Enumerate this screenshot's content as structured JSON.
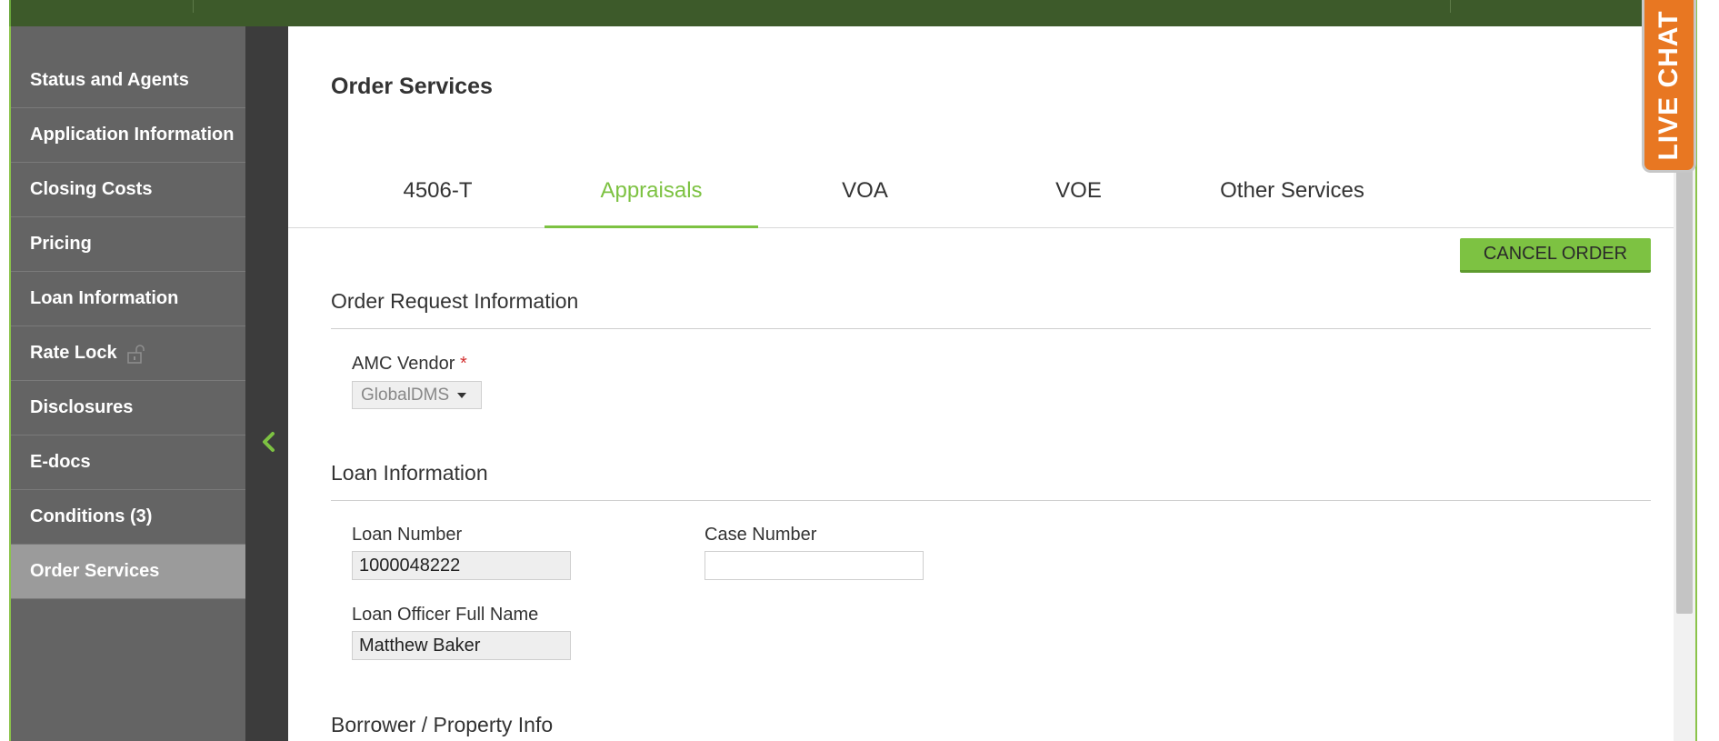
{
  "sidebar": {
    "items": [
      {
        "label": "Status and Agents"
      },
      {
        "label": "Application Information"
      },
      {
        "label": "Closing Costs"
      },
      {
        "label": "Pricing"
      },
      {
        "label": "Loan Information"
      },
      {
        "label": "Rate Lock",
        "icon": "unlock-icon"
      },
      {
        "label": "Disclosures"
      },
      {
        "label": "E-docs"
      },
      {
        "label": "Conditions (3)"
      },
      {
        "label": "Order Services",
        "active": true
      }
    ]
  },
  "main": {
    "page_title": "Order Services",
    "tabs": [
      {
        "label": "4506-T"
      },
      {
        "label": "Appraisals",
        "active": true
      },
      {
        "label": "VOA"
      },
      {
        "label": "VOE"
      },
      {
        "label": "Other Services"
      }
    ],
    "cancel_button": "CANCEL ORDER",
    "order_request": {
      "title": "Order Request Information",
      "amc_vendor_label": "AMC Vendor",
      "required_mark": "*",
      "amc_vendor_value": "GlobalDMS"
    },
    "loan_info": {
      "title": "Loan Information",
      "loan_number_label": "Loan Number",
      "loan_number_value": "1000048222",
      "case_number_label": "Case Number",
      "case_number_value": "",
      "loan_officer_label": "Loan Officer Full Name",
      "loan_officer_value": "Matthew Baker"
    },
    "borrower_section_title": "Borrower / Property Info"
  },
  "live_chat": "LIVE CHAT",
  "colors": {
    "accent_green": "#7dc242",
    "topbar_green": "#3d5a2a",
    "sidebar_gray": "#646464",
    "sidebar_active": "#9b9b9b",
    "live_chat_orange": "#e87722",
    "required_red": "#d32f2f"
  }
}
